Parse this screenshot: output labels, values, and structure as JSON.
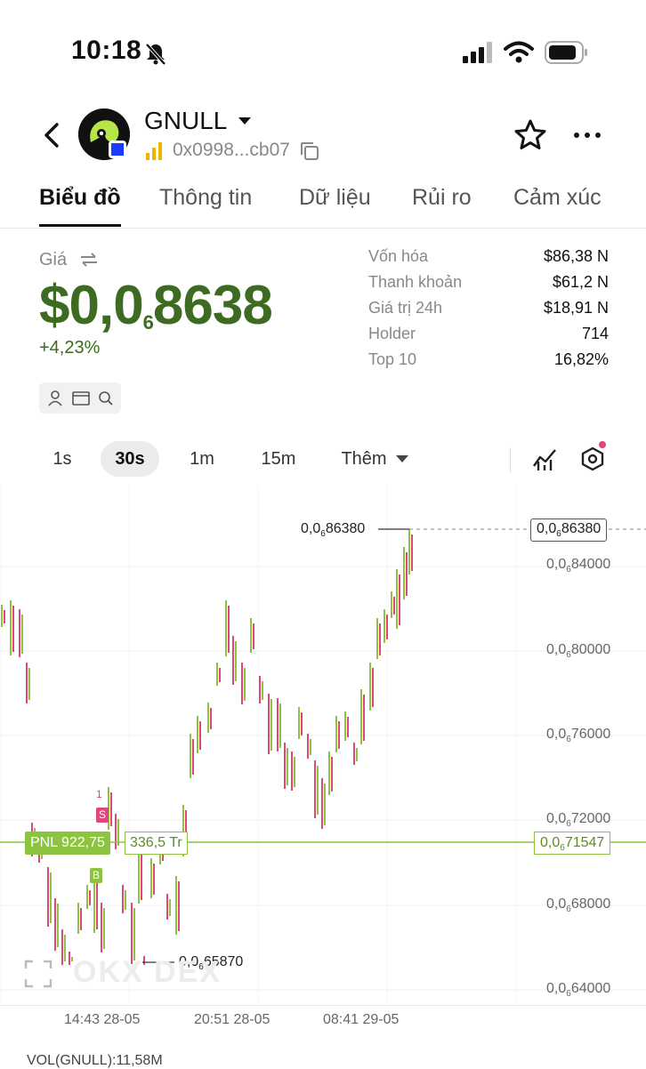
{
  "status_bar": {
    "time": "10:18"
  },
  "token": {
    "name": "GNULL",
    "address": "0x0998...cb07"
  },
  "tabs": [
    {
      "label": "Biểu đồ",
      "active": true
    },
    {
      "label": "Thông tin",
      "active": false
    },
    {
      "label": "Dữ liệu",
      "active": false
    },
    {
      "label": "Rủi ro",
      "active": false
    },
    {
      "label": "Cảm xúc",
      "active": false
    }
  ],
  "price": {
    "label": "Giá",
    "prefix": "$0,0",
    "zeros": "6",
    "digits": "8638",
    "change": "+4,23%",
    "color": "#3d6b22"
  },
  "stats": [
    {
      "key": "Vốn hóa",
      "value": "$86,38 N"
    },
    {
      "key": "Thanh khoản",
      "value": "$61,2 N"
    },
    {
      "key": "Giá trị 24h",
      "value": "$18,91 N"
    },
    {
      "key": "Holder",
      "value": "714"
    },
    {
      "key": "Top 10",
      "value": "16,82%"
    }
  ],
  "timeframes": [
    {
      "label": "1s",
      "active": false
    },
    {
      "label": "30s",
      "active": true
    },
    {
      "label": "1m",
      "active": false
    },
    {
      "label": "15m",
      "active": false
    },
    {
      "label": "Thêm",
      "active": false
    }
  ],
  "chart": {
    "y_axis": [
      {
        "prefix": "0,0",
        "zeros": "6",
        "digits": "84000"
      },
      {
        "prefix": "0,0",
        "zeros": "6",
        "digits": "80000"
      },
      {
        "prefix": "0,0",
        "zeros": "6",
        "digits": "76000"
      },
      {
        "prefix": "0,0",
        "zeros": "6",
        "digits": "72000"
      },
      {
        "prefix": "0,0",
        "zeros": "6",
        "digits": "68000"
      },
      {
        "prefix": "0,0",
        "zeros": "6",
        "digits": "64000"
      }
    ],
    "x_axis": [
      "14:43 28-05",
      "20:51 28-05",
      "08:41 29-05"
    ],
    "high_label": {
      "prefix": "0,0",
      "zeros": "6",
      "digits": "86380"
    },
    "low_label": {
      "prefix": "0,0",
      "zeros": "6",
      "digits": "65870"
    },
    "current_price": {
      "prefix": "0,0",
      "zeros": "6",
      "digits": "86380"
    },
    "pnl_label": "PNL 922,75",
    "pnl_amount": "336,5 Tr",
    "avg_price": {
      "prefix": "0,0",
      "zeros": "6",
      "digits": "71547"
    },
    "marker_sell": "S",
    "marker_buy": "B",
    "marker_one": "1",
    "watermark": "OKX DEX",
    "volume_label": "VOL(GNULL):11,58M",
    "up_color": "#8cc43f",
    "down_color": "#e0457b"
  }
}
